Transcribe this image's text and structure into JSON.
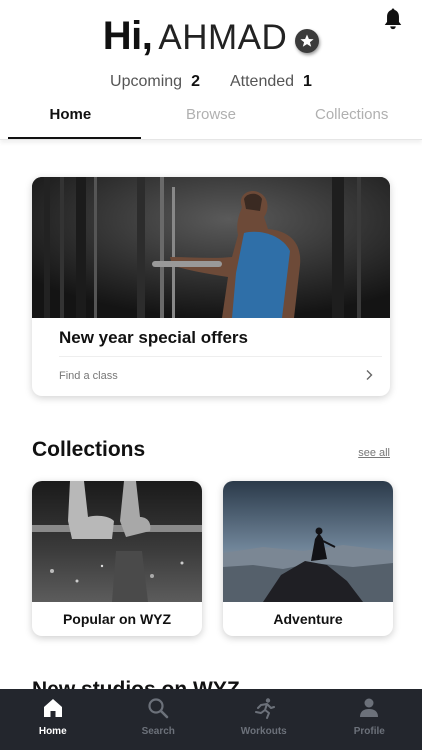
{
  "header": {
    "greeting": "Hi,",
    "user_name": "AHMAD",
    "stats": [
      {
        "label": "Upcoming",
        "value": "2"
      },
      {
        "label": "Attended",
        "value": "1"
      }
    ],
    "bell_icon": "bell-icon",
    "badge_icon": "star-icon"
  },
  "tabs": [
    {
      "label": "Home",
      "active": true
    },
    {
      "label": "Browse",
      "active": false
    },
    {
      "label": "Collections",
      "active": false
    }
  ],
  "hero": {
    "title": "New year special offers",
    "link_label": "Find a class"
  },
  "collections": {
    "title": "Collections",
    "see_all": "see all",
    "items": [
      {
        "label": "Popular on WYZ"
      },
      {
        "label": "Adventure"
      }
    ]
  },
  "next_section": {
    "title": "New studios on WYZ"
  },
  "bottom_nav": [
    {
      "label": "Home",
      "icon": "home-icon",
      "active": true
    },
    {
      "label": "Search",
      "icon": "search-icon",
      "active": false
    },
    {
      "label": "Workouts",
      "icon": "runner-icon",
      "active": false
    },
    {
      "label": "Profile",
      "icon": "person-icon",
      "active": false
    }
  ],
  "colors": {
    "nav_background": "#23262d",
    "nav_inactive": "#6c717a",
    "nav_active": "#ffffff",
    "tab_inactive": "#b0b0b0"
  }
}
